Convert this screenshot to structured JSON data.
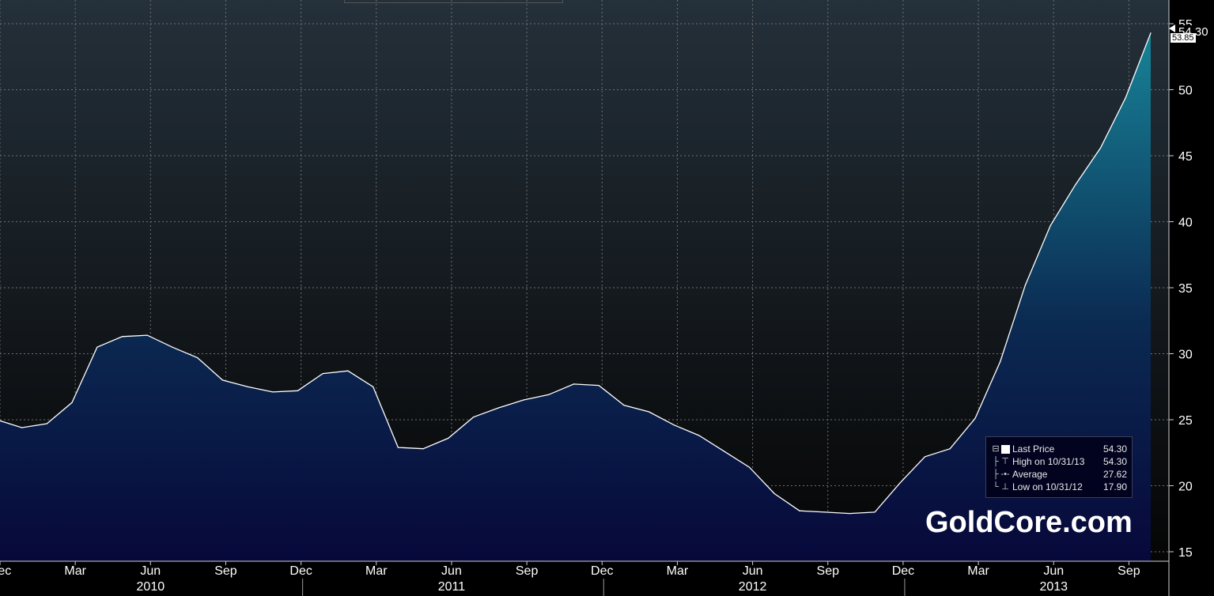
{
  "chart_data": {
    "type": "area",
    "title": "",
    "xlabel": "",
    "ylabel": "",
    "ylim": [
      14,
      56
    ],
    "y_ticks": [
      15,
      20,
      25,
      30,
      35,
      40,
      45,
      50,
      55
    ],
    "grid": true,
    "x_month_ticks": [
      {
        "label": "Dec",
        "x": "2009-12"
      },
      {
        "label": "Mar",
        "x": "2010-03"
      },
      {
        "label": "Jun",
        "x": "2010-06"
      },
      {
        "label": "Sep",
        "x": "2010-09"
      },
      {
        "label": "Dec",
        "x": "2010-12"
      },
      {
        "label": "Mar",
        "x": "2011-03"
      },
      {
        "label": "Jun",
        "x": "2011-06"
      },
      {
        "label": "Sep",
        "x": "2011-09"
      },
      {
        "label": "Dec",
        "x": "2011-12"
      },
      {
        "label": "Mar",
        "x": "2012-03"
      },
      {
        "label": "Jun",
        "x": "2012-06"
      },
      {
        "label": "Sep",
        "x": "2012-09"
      },
      {
        "label": "Dec",
        "x": "2012-12"
      },
      {
        "label": "Mar",
        "x": "2013-03"
      },
      {
        "label": "Jun",
        "x": "2013-06"
      },
      {
        "label": "Sep",
        "x": "2013-09"
      }
    ],
    "x_year_labels": [
      {
        "label": "2010",
        "x": "2010-06"
      },
      {
        "label": "2011",
        "x": "2011-06"
      },
      {
        "label": "2012",
        "x": "2012-06"
      },
      {
        "label": "2013",
        "x": "2013-06"
      }
    ],
    "series": [
      {
        "name": "Last Price",
        "x": [
          "2009-12",
          "2010-01",
          "2010-02",
          "2010-03",
          "2010-04",
          "2010-05",
          "2010-06",
          "2010-07",
          "2010-08",
          "2010-09",
          "2010-10",
          "2010-11",
          "2010-12",
          "2011-01",
          "2011-02",
          "2011-03",
          "2011-04",
          "2011-05",
          "2011-06",
          "2011-07",
          "2011-08",
          "2011-09",
          "2011-10",
          "2011-11",
          "2011-12",
          "2012-01",
          "2012-02",
          "2012-03",
          "2012-04",
          "2012-05",
          "2012-06",
          "2012-07",
          "2012-08",
          "2012-09",
          "2012-10",
          "2012-11",
          "2012-12",
          "2013-01",
          "2013-02",
          "2013-03",
          "2013-04",
          "2013-05",
          "2013-06",
          "2013-07",
          "2013-08",
          "2013-09",
          "2013-10"
        ],
        "values": [
          25.0,
          24.4,
          24.7,
          26.3,
          30.5,
          31.3,
          31.4,
          30.5,
          29.7,
          28.0,
          27.5,
          27.1,
          27.2,
          28.5,
          28.7,
          27.5,
          22.9,
          22.8,
          23.6,
          25.2,
          25.9,
          26.5,
          26.9,
          27.7,
          27.6,
          26.1,
          25.6,
          24.6,
          23.8,
          22.6,
          21.4,
          19.4,
          18.1,
          18.0,
          17.9,
          18.0,
          20.2,
          22.2,
          22.8,
          25.1,
          29.4,
          35.2,
          39.7,
          42.8,
          45.6,
          49.4,
          54.3
        ]
      }
    ],
    "last_value_tag": "54.30",
    "previous_value_tag": "53.85",
    "legend_position": "bottom-right",
    "legend": [
      {
        "marker": "square",
        "label": "Last Price",
        "value": "54.30"
      },
      {
        "marker": "high",
        "label": "High on 10/31/13",
        "value": "54.30"
      },
      {
        "marker": "average",
        "label": "Average",
        "value": "27.62"
      },
      {
        "marker": "low",
        "label": "Low on 10/31/12",
        "value": "17.90"
      }
    ],
    "colors": {
      "background_top": "#24303a",
      "background_bottom": "#050505",
      "area_top": "#178397",
      "area_bottom": "#07083a",
      "line": "#ffffff",
      "grid": "#6e6e6e"
    }
  },
  "watermark": "GoldCore.com"
}
